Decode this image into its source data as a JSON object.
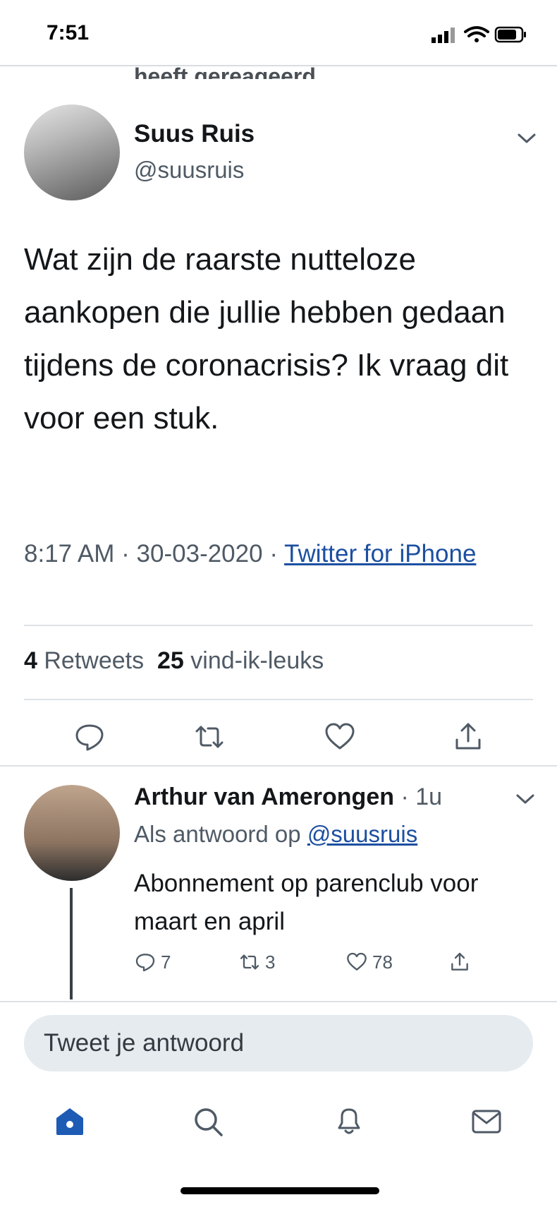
{
  "status_bar": {
    "time": "7:51"
  },
  "context": {
    "text": "heeft gereageerd"
  },
  "tweet": {
    "author_name": "Suus Ruis",
    "author_handle": "@suusruis",
    "text": "Wat zijn de raarste nutteloze aankopen die jullie hebben gedaan tijdens de coronacrisis? Ik vraag dit voor een stuk.",
    "time": "8:17 AM",
    "date": "30-03-2020",
    "separator": "·",
    "source": "Twitter for iPhone",
    "retweets_count": "4",
    "retweets_label": "Retweets",
    "likes_count": "25",
    "likes_label": "vind-ik-leuks"
  },
  "reply": {
    "author_name": "Arthur van Amerongen",
    "time": "· 1u",
    "context_prefix": "Als antwoord op",
    "context_handle": "@suusruis",
    "text": "Abonnement op parenclub voor maart en april",
    "replies": "7",
    "retweets": "3",
    "likes": "78"
  },
  "composer": {
    "placeholder": "Tweet je antwoord"
  },
  "colors": {
    "link": "#1c4fa0",
    "nav_active": "#1d5bb5",
    "secondary_text": "#4f5a65"
  },
  "icons": [
    "signal-icon",
    "wifi-icon",
    "battery-icon",
    "chevron-down-icon",
    "reply-icon",
    "retweet-icon",
    "like-icon",
    "share-icon",
    "home-icon",
    "search-icon",
    "notifications-icon",
    "messages-icon"
  ]
}
